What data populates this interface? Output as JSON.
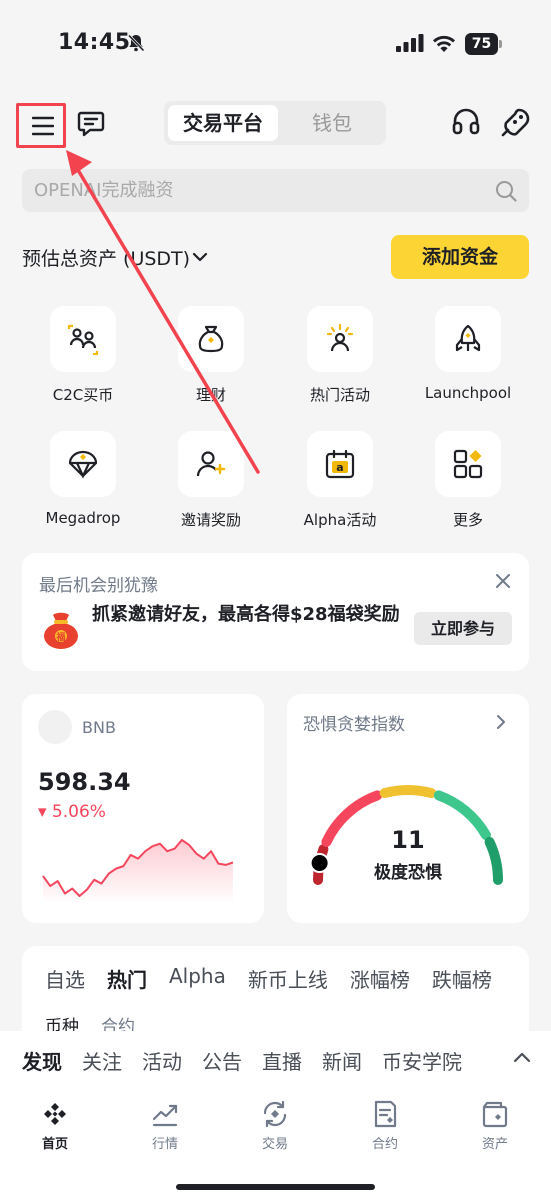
{
  "status_bar": {
    "time": "14:45",
    "battery": "75"
  },
  "header": {
    "menu_icon": "hamburger-menu-icon",
    "chat_icon": "message-icon",
    "segment": {
      "active": "交易平台",
      "inactive": "钱包"
    },
    "support_icon": "headset-icon",
    "profile_icon": "alien-mascot-icon"
  },
  "search": {
    "placeholder": "OPENAI完成融资",
    "icon": "search-icon"
  },
  "assets": {
    "label": "预估总资产 (USDT)",
    "add_funds": "添加资金"
  },
  "shortcuts": [
    {
      "label": "C2C买币",
      "icon": "c2c-people-icon"
    },
    {
      "label": "理财",
      "icon": "money-bag-icon"
    },
    {
      "label": "热门活动",
      "icon": "hot-event-icon"
    },
    {
      "label": "Launchpool",
      "icon": "rocket-icon"
    },
    {
      "label": "Megadrop",
      "icon": "parachute-icon"
    },
    {
      "label": "邀请奖励",
      "icon": "invite-user-icon"
    },
    {
      "label": "Alpha活动",
      "icon": "calendar-alpha-icon"
    },
    {
      "label": "更多",
      "icon": "more-grid-icon"
    }
  ],
  "promo": {
    "title": "最后机会别犹豫",
    "text": "抓紧邀请好友，最高各得$28福袋奖励",
    "button": "立即参与"
  },
  "bnb_card": {
    "symbol": "BNB",
    "price": "598.34",
    "change": "▾ 5.06%",
    "sparkline": [
      44,
      52,
      48,
      58,
      54,
      60,
      55,
      47,
      50,
      42,
      38,
      36,
      27,
      30,
      24,
      20,
      18,
      24,
      22,
      15,
      19,
      26,
      30,
      24,
      34,
      35,
      33
    ]
  },
  "fear_greed": {
    "title": "恐惧贪婪指数",
    "value": "11",
    "label": "极度恐惧",
    "level": 0.11
  },
  "market_tabs": [
    "自选",
    "热门",
    "Alpha",
    "新币上线",
    "涨幅榜",
    "跌幅榜"
  ],
  "market_active": "热门",
  "market_subtabs": [
    "币种",
    "合约"
  ],
  "discover_tabs": [
    "发现",
    "关注",
    "活动",
    "公告",
    "直播",
    "新闻",
    "币安学院"
  ],
  "nav": [
    {
      "label": "首页",
      "icon": "home-binance-icon"
    },
    {
      "label": "行情",
      "icon": "markets-chart-icon"
    },
    {
      "label": "交易",
      "icon": "trade-swap-icon"
    },
    {
      "label": "合约",
      "icon": "futures-doc-icon"
    },
    {
      "label": "资产",
      "icon": "wallet-icon"
    }
  ],
  "colors": {
    "accent": "#fcd535",
    "down": "#f6465d",
    "highlight": "#f2434f"
  }
}
